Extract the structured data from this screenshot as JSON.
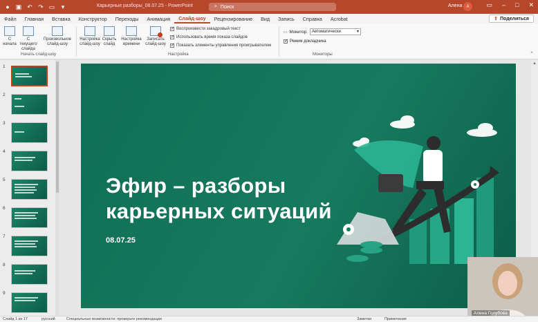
{
  "window": {
    "title": "Карьерные разборы_08.07.25  -  PowerPoint",
    "search_placeholder": "Поиск",
    "user_name": "Алена",
    "avatar_initial": "А"
  },
  "menu": {
    "tabs": [
      "Файл",
      "Главная",
      "Вставка",
      "Конструктор",
      "Переходы",
      "Анимация",
      "Слайд-шоу",
      "Рецензирование",
      "Вид",
      "Запись",
      "Справка",
      "Acrobat"
    ],
    "active": "Слайд-шоу",
    "share_label": "Поделиться"
  },
  "ribbon": {
    "start_group": {
      "label": "Начать слайд-шоу",
      "buttons": [
        "С начала",
        "С текущего слайда",
        "Произвольное слайд-шоу"
      ]
    },
    "setup_group": {
      "label": "Настройка",
      "buttons": [
        "Настройка слайд-шоу",
        "Скрыть слайд",
        "Настройка времени",
        "Записать слайд-шоу"
      ],
      "checkboxes": [
        "Воспроизвести закадровый текст",
        "Использовать время показа слайдов",
        "Показать элементы управления проигрывателем"
      ]
    },
    "monitors_group": {
      "label": "Мониторы",
      "monitor_label": "Монитор:",
      "monitor_value": "Автоматически",
      "presenter_label": "Режим докладчика"
    }
  },
  "thumbnails": [
    "1",
    "2",
    "3",
    "4",
    "5",
    "6",
    "7",
    "8",
    "9"
  ],
  "slide": {
    "title_line1": "Эфир – разборы",
    "title_line2": "карьерных ситуаций",
    "date": "08.07.25"
  },
  "webcam": {
    "name": "Алена Голубова"
  },
  "statusbar": {
    "slide_info": "Слайд 1 из 17",
    "language": "русский",
    "accessibility": "Специальные возможности: проверьте рекомендации",
    "notes": "Заметки",
    "comments": "Примечания"
  },
  "colors": {
    "brand": "#b7472a",
    "slide_green": "#177a5e"
  }
}
